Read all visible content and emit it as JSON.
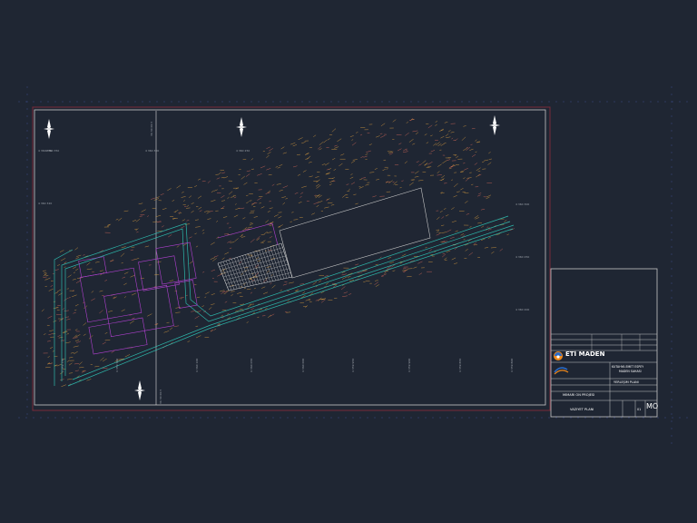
{
  "colors": {
    "background": "#1f2633",
    "frame_line": "#c6c6c6",
    "outer_border": "#7a2a3a",
    "crop_marks": "#3a4a8a",
    "contour_primary": "#e0a040",
    "contour_secondary": "#d96a5a",
    "road_lines": "#2fd0c0",
    "building_lines": "#b040d0",
    "building_fill": "#202633",
    "hatch": "#d8d8d8",
    "logo_orange": "#f08a1c",
    "logo_blue": "#2a6bc8"
  },
  "drawing": {
    "north_arrow_icons": [
      "north-arrow-icon",
      "north-arrow-icon",
      "north-arrow-icon",
      "north-arrow-icon"
    ],
    "grid_labels_top": [
      "4 360 350",
      "4 360 300",
      "4 360 250"
    ],
    "grid_labels_left": [
      "4 360 370",
      "4 360 320"
    ],
    "grid_labels_bottom": [
      "4 360 100",
      "4 360 050",
      "4 360 000",
      "4 359 950",
      "4 359 900",
      "4 359 850",
      "4 359 800",
      "4 359 750",
      "4 359 700"
    ],
    "grid_labels_right": [
      "4 360 300",
      "4 360 250",
      "4 360 200"
    ],
    "vertical_line_labels": [
      "36 30 00.5",
      "36 30 00.5"
    ]
  },
  "title_block": {
    "company_name": "ETİ MADEN",
    "project_title_line1": "KÜTAHYA EMET ESPEY",
    "project_title_line2": "MADEN SAHASI",
    "project_subtitle": "YERLEŞİM PLANI",
    "stage_label": "MİMARİ ÖN PROJESİ",
    "sheet_name": "VAZİYET PLANI",
    "drawing_code": "MÖ",
    "sheet_number": "01"
  }
}
